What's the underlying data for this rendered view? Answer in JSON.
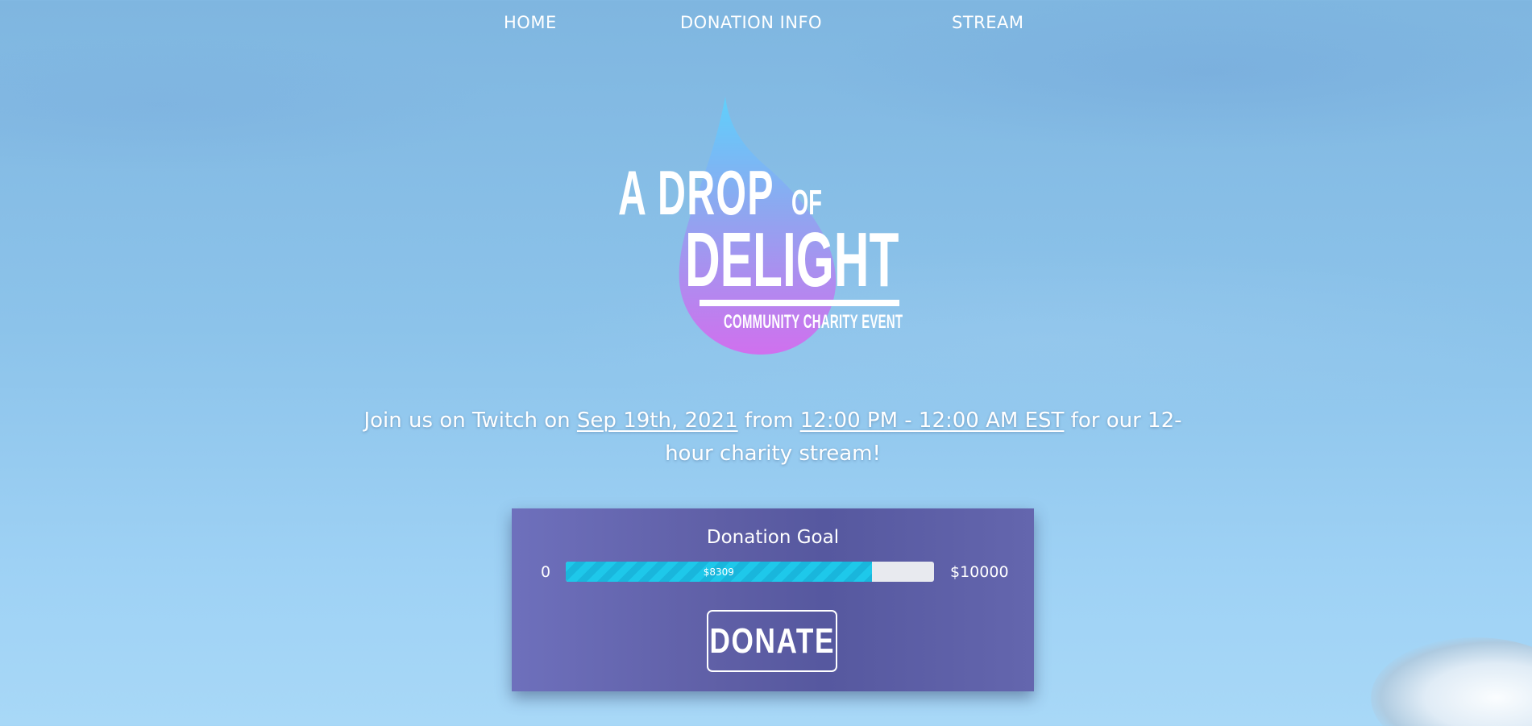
{
  "nav": {
    "home": "HOME",
    "donation_info": "DONATION INFO",
    "stream": "STREAM"
  },
  "logo": {
    "line1": "A DROP",
    "line1_small": "OF",
    "line2": "DELIGHT",
    "subtitle": "COMMUNITY CHARITY EVENT",
    "colors": {
      "drop_top": "#5fd0fb",
      "drop_mid": "#8fa6f0",
      "drop_bottom": "#d070ee"
    }
  },
  "tagline": {
    "prefix": "Join us on Twitch on ",
    "date": "Sep 19th, 2021",
    "middle": " from ",
    "time": "12:00 PM - 12:00 AM EST",
    "suffix": " for our 12-hour charity stream!"
  },
  "donation": {
    "title": "Donation Goal",
    "min_label": "0",
    "max_label": "$10000",
    "current_label": "$8309",
    "current": 8309,
    "goal": 10000,
    "button_label": "DONATE"
  }
}
